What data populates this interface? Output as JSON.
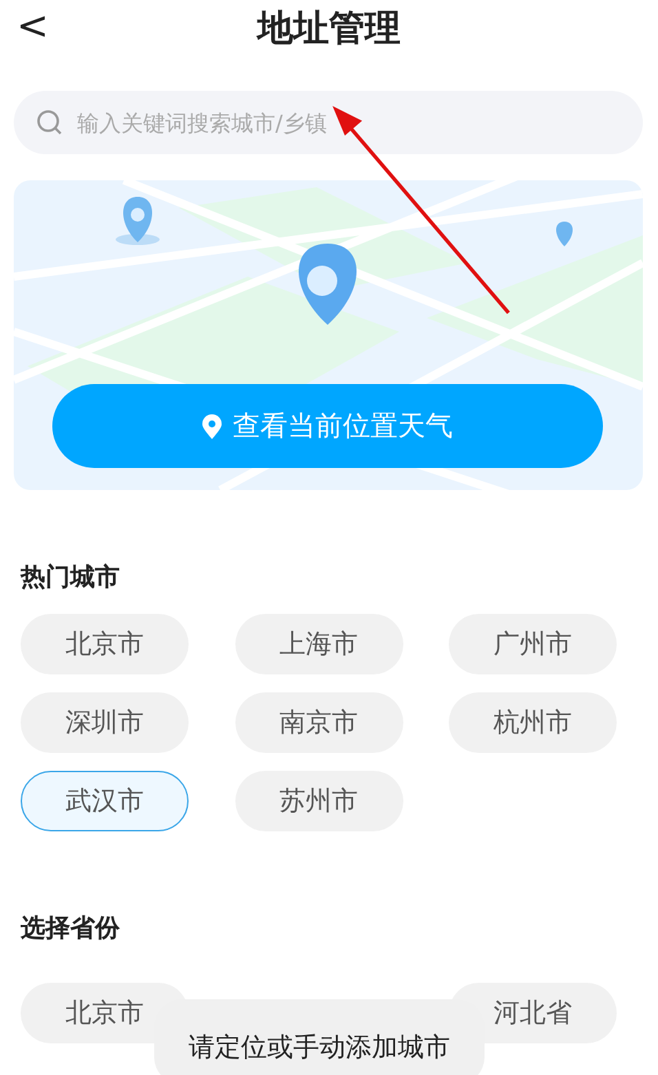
{
  "header": {
    "back": "<",
    "title": "地址管理"
  },
  "search": {
    "placeholder": "输入关键词搜索城市/乡镇"
  },
  "map_card": {
    "kind": "picture",
    "button": "查看当前位置天气"
  },
  "hot_cities": {
    "title": "热门城市",
    "items": [
      {
        "name": "北京市",
        "selected": false
      },
      {
        "name": "上海市",
        "selected": false
      },
      {
        "name": "广州市",
        "selected": false
      },
      {
        "name": "深圳市",
        "selected": false
      },
      {
        "name": "南京市",
        "selected": false
      },
      {
        "name": "杭州市",
        "selected": false
      },
      {
        "name": "武汉市",
        "selected": true
      },
      {
        "name": "苏州市",
        "selected": false
      }
    ]
  },
  "provinces": {
    "title": "选择省份",
    "items": [
      "北京市",
      "河北省"
    ]
  },
  "toast": "请定位或手动添加城市"
}
